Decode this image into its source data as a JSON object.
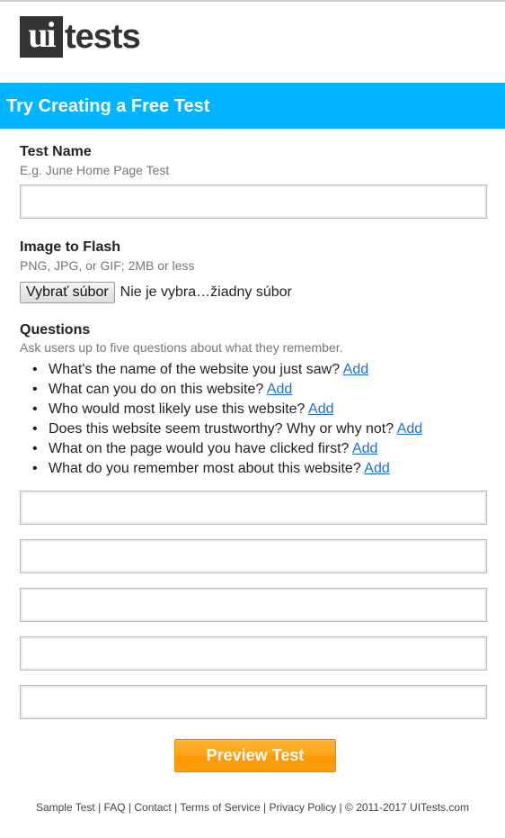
{
  "logo": {
    "mark": "ui",
    "word": "tests"
  },
  "banner": {
    "title": "Try Creating a Free Test"
  },
  "test_name": {
    "label": "Test Name",
    "hint": "E.g. June Home Page Test",
    "value": ""
  },
  "image": {
    "label": "Image to Flash",
    "hint": "PNG, JPG, or GIF; 2MB or less",
    "button_label": "Vybrať súbor",
    "status": "Nie je vybra…žiadny súbor"
  },
  "questions": {
    "label": "Questions",
    "hint": "Ask users up to five questions about what they remember.",
    "bullet": "•",
    "add_label": "Add",
    "suggestions": [
      "What's the name of the website you just saw?",
      "What can you do on this website?",
      "Who would most likely use this website?",
      "Does this website seem trustworthy? Why or why not?",
      "What on the page would you have clicked first?",
      "What do you remember most about this website?"
    ],
    "inputs": [
      "",
      "",
      "",
      "",
      ""
    ]
  },
  "preview_button": {
    "label": "Preview Test"
  },
  "footer": {
    "links": [
      "Sample Test",
      "FAQ",
      "Contact",
      "Terms of Service",
      "Privacy Policy"
    ],
    "separator": "|",
    "copyright": "© 2011-2017 UITests.com"
  },
  "colors": {
    "banner": "#00b4ff",
    "link": "#1a6fd6",
    "button": "#ff9d0a"
  }
}
